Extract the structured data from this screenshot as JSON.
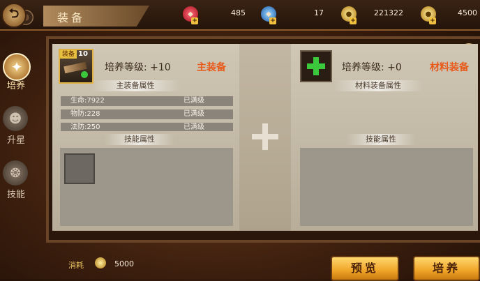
{
  "header": {
    "title": "装备"
  },
  "currencies": [
    {
      "icon": "red-gem-icon",
      "value": "485",
      "color": "#d8283c"
    },
    {
      "icon": "blue-gem-icon",
      "value": "17",
      "color": "#3a8ad8"
    },
    {
      "icon": "gold-coin-icon",
      "value": "221322",
      "color": "#e0b040"
    },
    {
      "icon": "gold-coin-icon",
      "value": "4500",
      "color": "#e0b040"
    }
  ],
  "help": {
    "label": "?"
  },
  "nav": {
    "items": [
      {
        "label": "培养",
        "icon": "star-icon",
        "active": true
      },
      {
        "label": "升星",
        "icon": "bust-icon",
        "active": false
      },
      {
        "label": "技能",
        "icon": "swirl-icon",
        "active": false
      }
    ]
  },
  "main_equip": {
    "badge": "装备",
    "level_badge": "10",
    "level_label": "培养等级: +10",
    "kind": "主装备",
    "attr_header": "主装备属性",
    "stats": [
      {
        "label": "生命:7922",
        "status": "已满级"
      },
      {
        "label": "物防:228",
        "status": "已满级"
      },
      {
        "label": "法防:250",
        "status": "已满级"
      }
    ],
    "skill_header": "技能属性"
  },
  "material_equip": {
    "level_label": "培养等级: +0",
    "kind": "材料装备",
    "attr_header": "材料装备属性",
    "skill_header": "技能属性"
  },
  "footer": {
    "cost_label": "消耗",
    "cost_value": "5000",
    "preview_button": "预览",
    "train_button": "培养"
  },
  "colors": {
    "accent_orange": "#e85a1a",
    "button_gold": "#f0a428",
    "green_plus": "#3cc83c"
  }
}
